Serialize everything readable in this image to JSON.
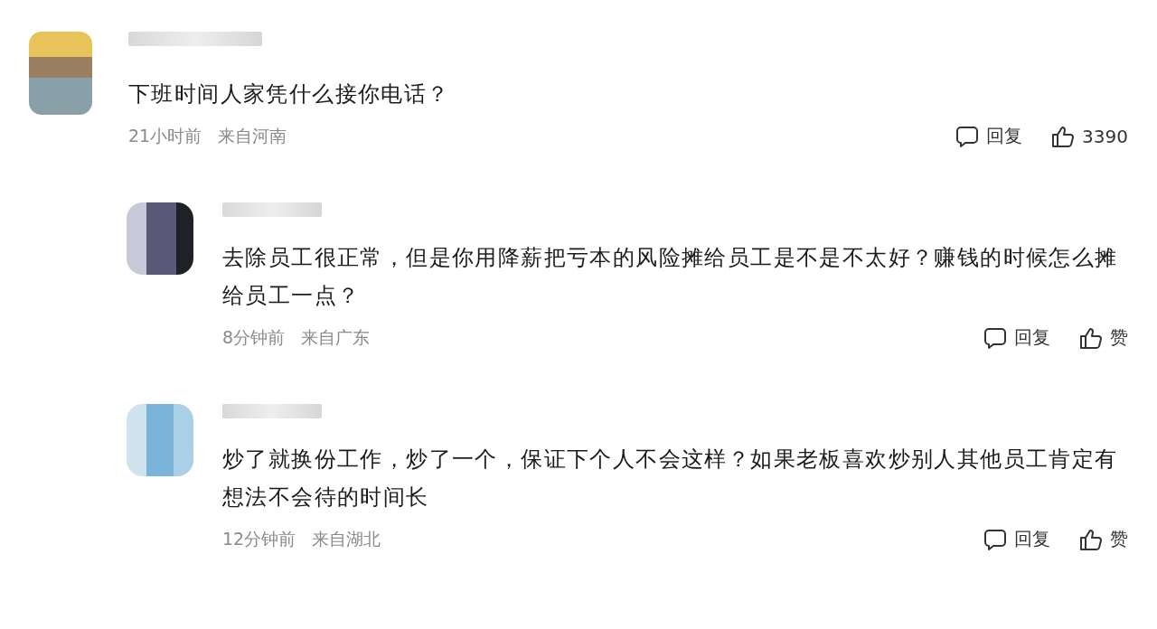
{
  "comments": [
    {
      "text": "下班时间人家凭什么接你电话？",
      "time": "21小时前",
      "location": "来自河南",
      "reply_label": "回复",
      "like_label": "3390",
      "children": [
        {
          "text": "去除员工很正常，但是你用降薪把亏本的风险摊给员工是不是不太好？赚钱的时候怎么摊给员工一点？",
          "time": "8分钟前",
          "location": "来自广东",
          "reply_label": "回复",
          "like_label": "赞"
        },
        {
          "text": "炒了就换份工作，炒了一个，保证下个人不会这样？如果老板喜欢炒别人其他员工肯定有想法不会待的时间长",
          "time": "12分钟前",
          "location": "来自湖北",
          "reply_label": "回复",
          "like_label": "赞"
        }
      ]
    }
  ]
}
